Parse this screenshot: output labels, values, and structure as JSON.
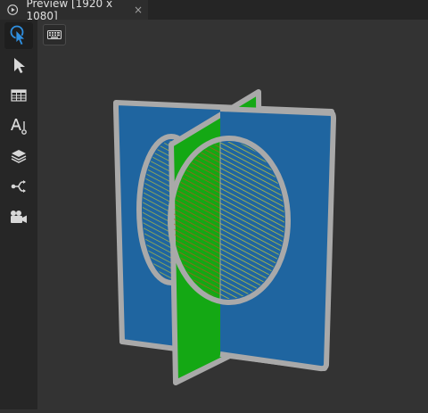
{
  "window": {
    "tab_title": "Preview [1920 x 1080]",
    "tab_close": "×"
  },
  "toolbar": {
    "tools": [
      {
        "name": "interact-tool-icon",
        "active": true
      },
      {
        "name": "select-tool-icon",
        "active": false
      },
      {
        "name": "table-tool-icon",
        "active": false
      },
      {
        "name": "text-tool-icon",
        "active": false
      },
      {
        "name": "layers-tool-icon",
        "active": false
      },
      {
        "name": "bindings-tool-icon",
        "active": false
      },
      {
        "name": "camera-tool-icon",
        "active": false
      }
    ]
  },
  "preview": {
    "keyboard_button": "keyboard-icon",
    "colors": {
      "panel_blue": "#1f65a0",
      "panel_green": "#14a814",
      "frame_gray": "#a9a9a9",
      "hatch_yellow": "#c8c832"
    }
  }
}
